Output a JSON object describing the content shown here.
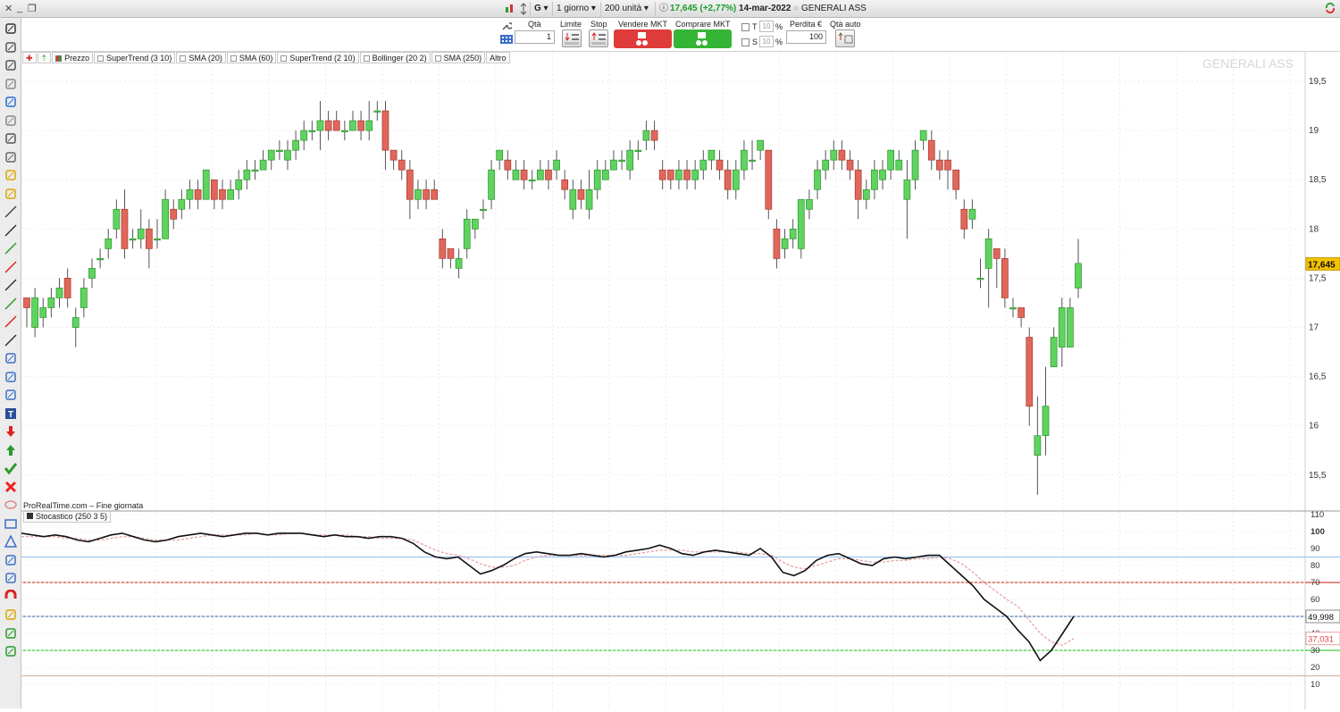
{
  "window": {
    "instrument_code": "G",
    "timeframe": "1 giorno",
    "units": "200 unità",
    "last_price": "17,645",
    "change": "(+2,77%)",
    "date": "14-mar-2022",
    "instrument_name": "GENERALI ASS"
  },
  "order": {
    "qty_label": "Qtà",
    "qty_value": "1",
    "limit_label": "Limite",
    "stop_label": "Stop",
    "sell_label": "Vendere MKT",
    "buy_label": "Comprare MKT",
    "t_label": "T",
    "s_label": "S",
    "t_pct": "10",
    "s_pct": "10",
    "pct_sign": "%",
    "loss_label": "Perdita €",
    "loss_value": "100",
    "auto_qty_label": "Qtà auto",
    "sell_color": "#e03b3b",
    "buy_color": "#35b535"
  },
  "indicators": {
    "items": [
      "Prezzo",
      "SuperTrend (3 10)",
      "SMA (20)",
      "SMA (60)",
      "SuperTrend (2 10)",
      "Bollinger (20 2)",
      "SMA (250)",
      "Altro"
    ]
  },
  "chart_labels": {
    "watermark": "GENERALI ASS",
    "source": "ProRealTime.com – Fine giornata",
    "stochastic": "Stocastico (250 3 5)",
    "price_ticks": [
      "19,5",
      "19",
      "18,5",
      "18",
      "17,5",
      "17",
      "16,5",
      "16",
      "15,5"
    ],
    "last_price_tag": "17,645",
    "stoch_ticks": [
      "110",
      "100",
      "90",
      "80",
      "70",
      "60",
      "50",
      "40",
      "30",
      "20",
      "10"
    ],
    "stoch_value_tag": "49,998",
    "stoch_signal_tag": "37,031"
  },
  "chart_data": [
    {
      "type": "candlestick",
      "title": "GENERALI ASS",
      "ylim": [
        15.2,
        19.7
      ],
      "candles": [
        [
          17.3,
          17.2,
          17.3,
          17.0
        ],
        [
          17.0,
          17.3,
          17.4,
          16.9
        ],
        [
          17.1,
          17.2,
          17.3,
          17.0
        ],
        [
          17.2,
          17.3,
          17.4,
          17.1
        ],
        [
          17.3,
          17.4,
          17.5,
          17.2
        ],
        [
          17.5,
          17.3,
          17.6,
          17.2
        ],
        [
          17.0,
          17.1,
          17.2,
          16.8
        ],
        [
          17.2,
          17.4,
          17.5,
          17.1
        ],
        [
          17.5,
          17.6,
          17.7,
          17.4
        ],
        [
          17.7,
          17.7,
          17.8,
          17.6
        ],
        [
          17.8,
          17.9,
          18.0,
          17.7
        ],
        [
          18.0,
          18.2,
          18.3,
          17.9
        ],
        [
          18.2,
          17.8,
          18.4,
          17.7
        ],
        [
          17.9,
          17.9,
          18.0,
          17.8
        ],
        [
          17.9,
          18.0,
          18.2,
          17.8
        ],
        [
          18.0,
          17.8,
          18.1,
          17.6
        ],
        [
          17.9,
          17.9,
          18.1,
          17.8
        ],
        [
          17.9,
          18.3,
          18.4,
          17.9
        ],
        [
          18.2,
          18.1,
          18.3,
          18.0
        ],
        [
          18.2,
          18.3,
          18.4,
          18.1
        ],
        [
          18.3,
          18.4,
          18.5,
          18.2
        ],
        [
          18.4,
          18.3,
          18.5,
          18.2
        ],
        [
          18.3,
          18.6,
          18.6,
          18.3
        ],
        [
          18.5,
          18.3,
          18.5,
          18.2
        ],
        [
          18.4,
          18.3,
          18.5,
          18.2
        ],
        [
          18.3,
          18.4,
          18.5,
          18.3
        ],
        [
          18.4,
          18.5,
          18.6,
          18.3
        ],
        [
          18.5,
          18.6,
          18.7,
          18.4
        ],
        [
          18.6,
          18.6,
          18.7,
          18.5
        ],
        [
          18.6,
          18.7,
          18.8,
          18.6
        ],
        [
          18.7,
          18.8,
          18.8,
          18.6
        ],
        [
          18.8,
          18.8,
          18.9,
          18.7
        ],
        [
          18.7,
          18.8,
          18.9,
          18.6
        ],
        [
          18.8,
          18.9,
          19.0,
          18.7
        ],
        [
          18.9,
          19.0,
          19.1,
          18.8
        ],
        [
          19.0,
          19.0,
          19.1,
          18.9
        ],
        [
          19.0,
          19.1,
          19.3,
          18.8
        ],
        [
          19.1,
          19.0,
          19.2,
          18.9
        ],
        [
          19.1,
          19.0,
          19.2,
          19.0
        ],
        [
          19.0,
          19.0,
          19.1,
          18.9
        ],
        [
          19.0,
          19.1,
          19.2,
          19.0
        ],
        [
          19.1,
          19.0,
          19.2,
          18.9
        ],
        [
          19.0,
          19.1,
          19.3,
          18.9
        ],
        [
          19.2,
          19.2,
          19.3,
          19.1
        ],
        [
          19.2,
          18.8,
          19.3,
          18.6
        ],
        [
          18.8,
          18.7,
          18.8,
          18.6
        ],
        [
          18.7,
          18.6,
          18.8,
          18.5
        ],
        [
          18.6,
          18.3,
          18.7,
          18.1
        ],
        [
          18.3,
          18.4,
          18.5,
          18.2
        ],
        [
          18.4,
          18.3,
          18.5,
          18.2
        ],
        [
          18.4,
          18.3,
          18.5,
          18.3
        ],
        [
          17.9,
          17.7,
          18.0,
          17.6
        ],
        [
          17.8,
          17.7,
          17.8,
          17.6
        ],
        [
          17.6,
          17.7,
          17.8,
          17.5
        ],
        [
          17.8,
          18.1,
          18.2,
          17.7
        ],
        [
          18.0,
          18.1,
          18.1,
          17.9
        ],
        [
          18.2,
          18.2,
          18.3,
          18.1
        ],
        [
          18.3,
          18.6,
          18.7,
          18.2
        ],
        [
          18.7,
          18.8,
          18.8,
          18.6
        ],
        [
          18.7,
          18.6,
          18.8,
          18.5
        ],
        [
          18.5,
          18.6,
          18.7,
          18.5
        ],
        [
          18.6,
          18.5,
          18.7,
          18.4
        ],
        [
          18.5,
          18.5,
          18.6,
          18.4
        ],
        [
          18.5,
          18.6,
          18.7,
          18.5
        ],
        [
          18.6,
          18.5,
          18.7,
          18.4
        ],
        [
          18.6,
          18.7,
          18.8,
          18.5
        ],
        [
          18.5,
          18.4,
          18.6,
          18.3
        ],
        [
          18.2,
          18.4,
          18.5,
          18.1
        ],
        [
          18.4,
          18.3,
          18.5,
          18.2
        ],
        [
          18.2,
          18.4,
          18.6,
          18.1
        ],
        [
          18.4,
          18.6,
          18.7,
          18.3
        ],
        [
          18.5,
          18.6,
          18.7,
          18.5
        ],
        [
          18.6,
          18.7,
          18.8,
          18.6
        ],
        [
          18.7,
          18.7,
          18.8,
          18.6
        ],
        [
          18.6,
          18.8,
          18.9,
          18.5
        ],
        [
          18.8,
          18.8,
          18.9,
          18.7
        ],
        [
          18.9,
          19.0,
          19.1,
          18.8
        ],
        [
          19.0,
          18.9,
          19.1,
          18.8
        ],
        [
          18.6,
          18.5,
          18.7,
          18.4
        ],
        [
          18.6,
          18.5,
          18.6,
          18.4
        ],
        [
          18.5,
          18.6,
          18.7,
          18.4
        ],
        [
          18.6,
          18.5,
          18.7,
          18.4
        ],
        [
          18.5,
          18.6,
          18.7,
          18.4
        ],
        [
          18.6,
          18.7,
          18.8,
          18.5
        ],
        [
          18.7,
          18.8,
          18.8,
          18.6
        ],
        [
          18.7,
          18.6,
          18.8,
          18.5
        ],
        [
          18.6,
          18.4,
          18.7,
          18.3
        ],
        [
          18.4,
          18.6,
          18.7,
          18.3
        ],
        [
          18.6,
          18.8,
          18.9,
          18.5
        ],
        [
          18.7,
          18.7,
          18.9,
          18.6
        ],
        [
          18.8,
          18.9,
          18.9,
          18.7
        ],
        [
          18.8,
          18.2,
          18.8,
          18.1
        ],
        [
          18.0,
          17.7,
          18.1,
          17.6
        ],
        [
          17.8,
          17.9,
          18.0,
          17.7
        ],
        [
          17.9,
          18.0,
          18.1,
          17.8
        ],
        [
          17.8,
          18.3,
          18.3,
          17.7
        ],
        [
          18.2,
          18.3,
          18.4,
          18.1
        ],
        [
          18.4,
          18.6,
          18.7,
          18.3
        ],
        [
          18.6,
          18.7,
          18.8,
          18.5
        ],
        [
          18.7,
          18.8,
          18.9,
          18.6
        ],
        [
          18.8,
          18.7,
          18.9,
          18.6
        ],
        [
          18.7,
          18.6,
          18.8,
          18.5
        ],
        [
          18.6,
          18.3,
          18.7,
          18.1
        ],
        [
          18.3,
          18.4,
          18.5,
          18.2
        ],
        [
          18.4,
          18.6,
          18.7,
          18.3
        ],
        [
          18.5,
          18.6,
          18.7,
          18.4
        ],
        [
          18.6,
          18.8,
          18.8,
          18.5
        ],
        [
          18.6,
          18.7,
          18.8,
          18.6
        ],
        [
          18.3,
          18.5,
          18.7,
          17.9
        ],
        [
          18.5,
          18.8,
          18.9,
          18.4
        ],
        [
          18.9,
          19.0,
          19.0,
          18.8
        ],
        [
          18.9,
          18.7,
          19.0,
          18.6
        ],
        [
          18.7,
          18.6,
          18.8,
          18.5
        ],
        [
          18.7,
          18.6,
          18.8,
          18.4
        ],
        [
          18.6,
          18.4,
          18.6,
          18.3
        ],
        [
          18.2,
          18.0,
          18.3,
          17.9
        ],
        [
          18.1,
          18.2,
          18.3,
          18.0
        ],
        [
          17.5,
          17.5,
          17.7,
          17.4
        ],
        [
          17.6,
          17.9,
          18.0,
          17.2
        ],
        [
          17.8,
          17.7,
          17.8,
          17.4
        ],
        [
          17.7,
          17.3,
          17.8,
          17.2
        ],
        [
          17.2,
          17.2,
          17.3,
          17.1
        ],
        [
          17.2,
          17.1,
          17.2,
          17.0
        ],
        [
          16.9,
          16.2,
          17.0,
          16.0
        ],
        [
          15.7,
          15.9,
          16.3,
          15.3
        ],
        [
          15.9,
          16.2,
          16.6,
          15.7
        ],
        [
          16.6,
          16.9,
          17.0,
          16.6
        ],
        [
          16.8,
          17.2,
          17.3,
          16.6
        ],
        [
          16.8,
          17.2,
          17.3,
          16.8
        ],
        [
          17.4,
          17.65,
          17.9,
          17.3
        ]
      ]
    },
    {
      "type": "line",
      "title": "Stocastico (250 3 5)",
      "ylim": [
        0,
        115
      ],
      "series": [
        {
          "values": [
            99,
            98,
            97,
            98,
            97,
            95,
            94,
            96,
            98,
            99,
            97,
            95,
            94,
            95,
            97,
            98,
            99,
            98,
            97,
            98,
            99,
            99,
            98,
            99,
            99,
            99,
            98,
            97,
            98,
            97,
            97,
            96,
            97,
            97,
            96,
            93,
            88,
            85,
            84,
            85,
            80,
            75,
            77,
            80,
            84,
            87,
            88,
            87,
            86,
            86,
            87,
            86,
            85,
            86,
            88,
            89,
            90,
            92,
            90,
            87,
            86,
            88,
            89,
            88,
            87,
            86,
            90,
            85,
            76,
            74,
            77,
            83,
            86,
            87,
            84,
            81,
            80,
            84,
            85,
            84,
            85,
            86,
            86,
            80,
            74,
            68,
            60,
            55,
            50,
            42,
            35,
            24,
            30,
            40,
            50
          ]
        },
        {
          "values": [
            97,
            97,
            97,
            97,
            96,
            96,
            95,
            95,
            96,
            97,
            97,
            96,
            95,
            95,
            95,
            96,
            97,
            98,
            98,
            98,
            98,
            99,
            98,
            98,
            99,
            99,
            98,
            98,
            98,
            98,
            97,
            97,
            96,
            96,
            96,
            95,
            92,
            89,
            87,
            86,
            84,
            81,
            79,
            79,
            80,
            83,
            85,
            86,
            86,
            86,
            86,
            86,
            86,
            86,
            86,
            87,
            88,
            89,
            89,
            89,
            88,
            88,
            88,
            88,
            88,
            87,
            87,
            86,
            82,
            79,
            78,
            80,
            82,
            84,
            84,
            83,
            82,
            82,
            83,
            83,
            84,
            84,
            85,
            84,
            81,
            76,
            70,
            65,
            60,
            56,
            48,
            40,
            35,
            33,
            37
          ]
        }
      ],
      "levels": [
        {
          "value": 85,
          "color": "#9fc3ef"
        },
        {
          "value": 70,
          "color": "#d24a3a"
        },
        {
          "value": 50,
          "color": "#5c7fb8"
        },
        {
          "value": 30,
          "color": "#3ccf3c"
        },
        {
          "value": 15,
          "color": "#d3b9a6"
        }
      ]
    }
  ]
}
